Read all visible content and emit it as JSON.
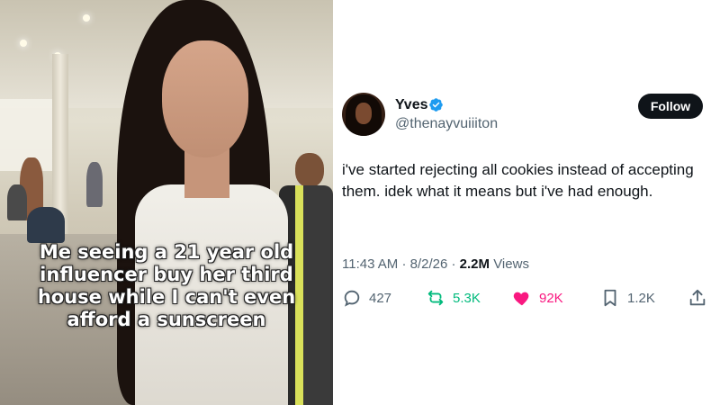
{
  "meme": {
    "caption_lines": [
      "Me seeing a 21 year old",
      "influencer buy her third",
      "house while I can't even",
      "afford a sunscreen"
    ]
  },
  "tweet": {
    "author": {
      "display_name": "Yves",
      "handle": "@thenayvuiiiton",
      "verified": true
    },
    "follow_label": "Follow",
    "text": "i've started rejecting all cookies instead of accepting them. idek what it means but i've had enough.",
    "meta": {
      "time": "11:43 AM",
      "date": "8/2/26",
      "views_count": "2.2M",
      "views_label": "Views",
      "separator": "·"
    },
    "actions": {
      "replies": "427",
      "reposts": "5.3K",
      "likes": "92K",
      "bookmarks": "1.2K"
    }
  },
  "colors": {
    "accent_blue": "#1d9bf0",
    "repost_green": "#00ba7c",
    "like_pink": "#f91880",
    "text_primary": "#0f1419",
    "text_secondary": "#536471"
  },
  "icons": [
    "verified-badge-icon",
    "reply-icon",
    "repost-icon",
    "like-heart-icon",
    "bookmark-icon",
    "share-icon"
  ]
}
